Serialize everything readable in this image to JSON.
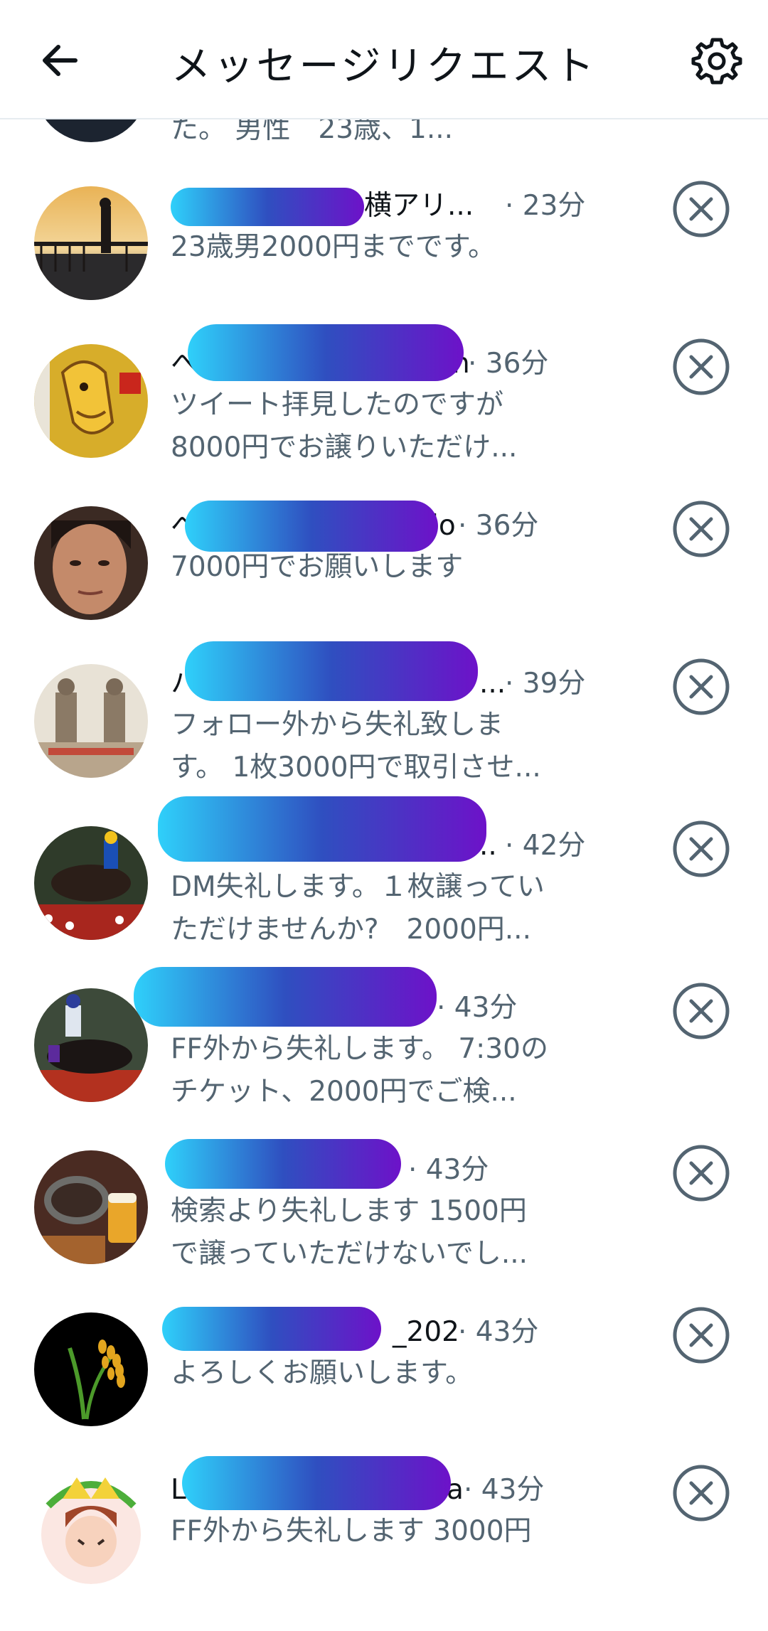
{
  "header": {
    "title": "メッセージリクエスト",
    "back_icon": "arrow-left-icon",
    "settings_icon": "gear-icon"
  },
  "partial_top": {
    "preview": "た。 男性　23歳、1..."
  },
  "requests": [
    {
      "name_prefix": "",
      "name_suffix": "横アリ...",
      "time": "23分",
      "preview": [
        "23歳男2000円までです。"
      ],
      "avatar": "sunset-pier-photo"
    },
    {
      "name_prefix": "へ",
      "name_suffix": "n",
      "time": "36分",
      "preview": [
        "ツイート拝見したのですが",
        "8000円でお譲りいただけ..."
      ],
      "avatar": "horse-cartoon-poster"
    },
    {
      "name_prefix": "へ",
      "name_suffix": "lo",
      "time": "36分",
      "preview": [
        "7000円でお願いします"
      ],
      "avatar": "man-face-photo"
    },
    {
      "name_prefix": "ハ",
      "name_suffix": "...",
      "time": "39分",
      "preview": [
        "フォロー外から失礼致しま",
        "す。 1枚3000円で取引させ..."
      ],
      "avatar": "temple-statues-photo"
    },
    {
      "name_prefix": "",
      "name_suffix": "..",
      "time": "42分",
      "preview": [
        "DM失礼します。１枚譲ってい",
        "ただけませんか?　2000円..."
      ],
      "avatar": "horse-race-photo"
    },
    {
      "name_prefix": "",
      "name_suffix": "",
      "time": "43分",
      "preview": [
        "FF外から失礼します。 7:30の",
        "チケット、2000円でご検..."
      ],
      "avatar": "jockey-horse-photo"
    },
    {
      "name_prefix": "",
      "name_suffix": "",
      "time": "43分",
      "preview": [
        "検索より失礼します 1500円",
        "で譲っていただけないでし..."
      ],
      "avatar": "yakiniku-beer-photo"
    },
    {
      "name_prefix": "",
      "name_suffix": "_202",
      "time": "43分",
      "preview": [
        "よろしくお願いします。"
      ],
      "avatar": "rice-plant-icon"
    },
    {
      "name_prefix": "L",
      "name_suffix": "a",
      "time": "43分",
      "preview": [
        "FF外から失礼します 3000円"
      ],
      "avatar": "anime-character-art"
    }
  ]
}
